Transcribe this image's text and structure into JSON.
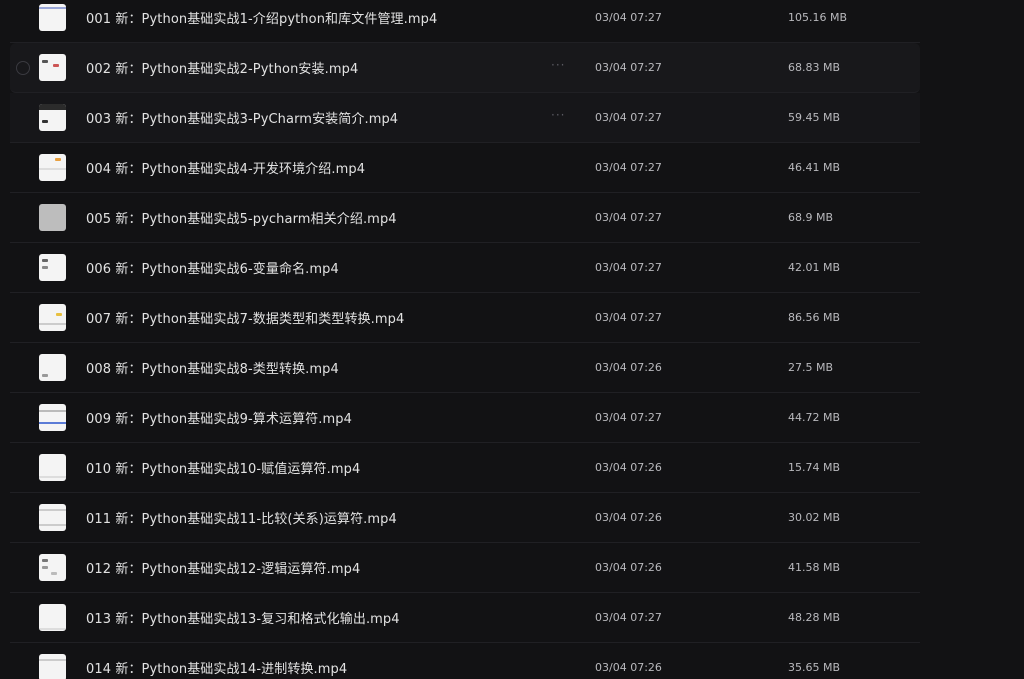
{
  "files": [
    {
      "name": "001 新：Python基础实战1-介绍python和库文件管理.mp4",
      "date": "03/04 07:27",
      "size": "105.16 MB"
    },
    {
      "name": "002 新：Python基础实战2-Python安装.mp4",
      "date": "03/04 07:27",
      "size": "68.83 MB"
    },
    {
      "name": "003 新：Python基础实战3-PyCharm安装简介.mp4",
      "date": "03/04 07:27",
      "size": "59.45 MB"
    },
    {
      "name": "004 新：Python基础实战4-开发环境介绍.mp4",
      "date": "03/04 07:27",
      "size": "46.41 MB"
    },
    {
      "name": "005 新：Python基础实战5-pycharm相关介绍.mp4",
      "date": "03/04 07:27",
      "size": "68.9 MB"
    },
    {
      "name": "006 新：Python基础实战6-变量命名.mp4",
      "date": "03/04 07:27",
      "size": "42.01 MB"
    },
    {
      "name": "007 新：Python基础实战7-数据类型和类型转换.mp4",
      "date": "03/04 07:27",
      "size": "86.56 MB"
    },
    {
      "name": "008 新：Python基础实战8-类型转换.mp4",
      "date": "03/04 07:26",
      "size": "27.5 MB"
    },
    {
      "name": "009 新：Python基础实战9-算术运算符.mp4",
      "date": "03/04 07:27",
      "size": "44.72 MB"
    },
    {
      "name": "010 新：Python基础实战10-赋值运算符.mp4",
      "date": "03/04 07:26",
      "size": "15.74 MB"
    },
    {
      "name": "011 新：Python基础实战11-比较(关系)运算符.mp4",
      "date": "03/04 07:26",
      "size": "30.02 MB"
    },
    {
      "name": "012 新：Python基础实战12-逻辑运算符.mp4",
      "date": "03/04 07:26",
      "size": "41.58 MB"
    },
    {
      "name": "013 新：Python基础实战13-复习和格式化输出.mp4",
      "date": "03/04 07:27",
      "size": "48.28 MB"
    },
    {
      "name": "014 新：Python基础实战14-进制转换.mp4",
      "date": "03/04 07:26",
      "size": "35.65 MB"
    }
  ],
  "row_more_label": "···",
  "icons": {
    "thumbnail": "video-thumbnail-icon",
    "more": "more-options-icon",
    "checkbox": "select-checkbox-icon"
  },
  "colors": {
    "background": "#121214",
    "text": "#e2e2e2",
    "meta_text": "#b9b9bd",
    "hover_row": "#18181b"
  }
}
